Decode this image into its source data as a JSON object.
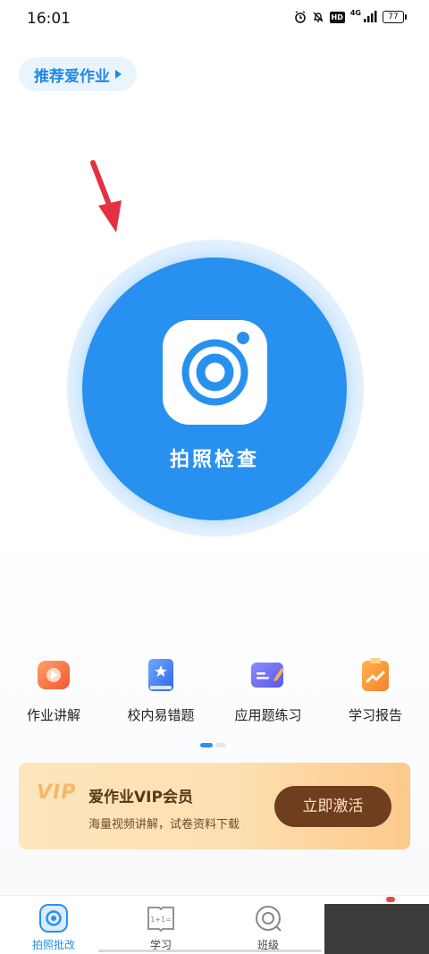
{
  "status_bar": {
    "time": "16:01",
    "hd": "HD",
    "network": "4G",
    "battery": "77"
  },
  "header": {
    "recommend_label": "推荐爱作业"
  },
  "camera": {
    "label": "拍照检查",
    "accent": "#2891ef"
  },
  "quick_actions": [
    {
      "label": "作业讲解",
      "icon": "video-lesson-icon"
    },
    {
      "label": "校内易错题",
      "icon": "error-book-icon"
    },
    {
      "label": "应用题练习",
      "icon": "practice-card-icon"
    },
    {
      "label": "学习报告",
      "icon": "report-clipboard-icon"
    }
  ],
  "vip": {
    "logo": "VIP",
    "title": "爱作业VIP会员",
    "subtitle": "海量视频讲解，试卷资料下载",
    "button": "立即激活"
  },
  "bottom_nav": [
    {
      "label": "拍照批改",
      "icon": "camera-scan-icon",
      "active": true
    },
    {
      "label": "学习",
      "icon": "book-math-icon",
      "active": false
    },
    {
      "label": "班级",
      "icon": "class-circle-icon",
      "active": false
    }
  ]
}
